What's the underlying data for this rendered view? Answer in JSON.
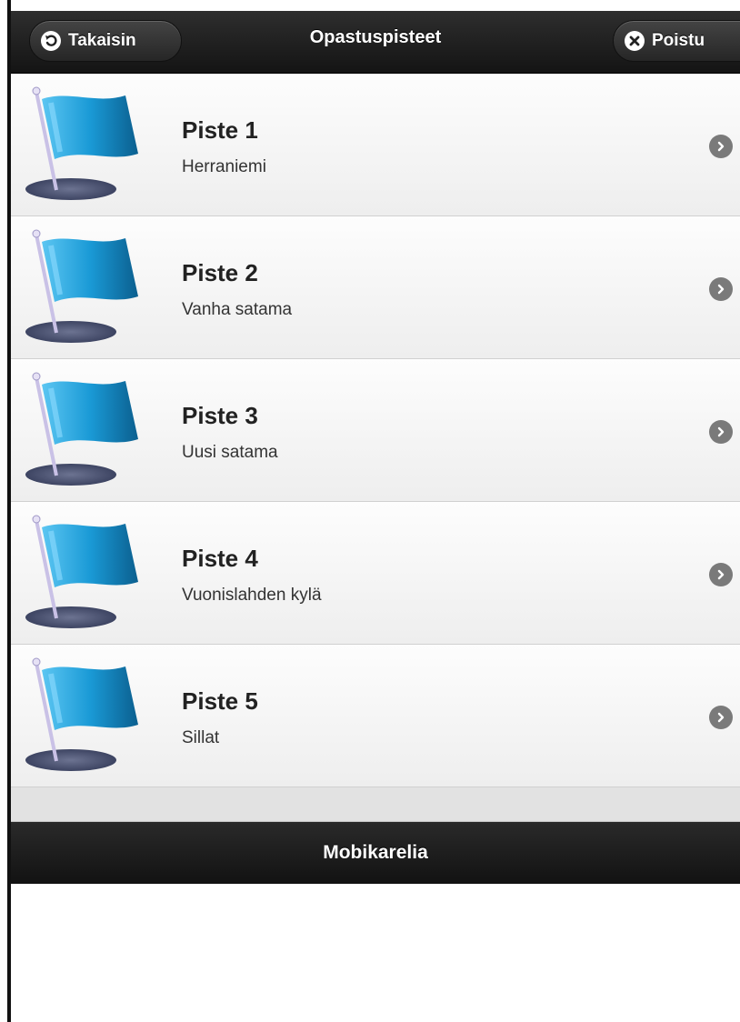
{
  "header": {
    "title": "Opastuspisteet",
    "back_label": "Takaisin",
    "back_icon": "back-arrow-icon",
    "exit_label": "Poistu",
    "exit_icon": "close-icon"
  },
  "items": [
    {
      "title": "Piste 1",
      "subtitle": "Herraniemi",
      "icon": "flag-icon"
    },
    {
      "title": "Piste 2",
      "subtitle": "Vanha satama",
      "icon": "flag-icon"
    },
    {
      "title": "Piste 3",
      "subtitle": "Uusi satama",
      "icon": "flag-icon"
    },
    {
      "title": "Piste 4",
      "subtitle": "Vuonislahden kylä",
      "icon": "flag-icon"
    },
    {
      "title": "Piste 5",
      "subtitle": "Sillat",
      "icon": "flag-icon"
    }
  ],
  "footer": {
    "title": "Mobikarelia"
  },
  "colors": {
    "header_bg": "#1e1e1e",
    "flag_blue": "#1a9ad6",
    "arrow_gray": "#7a7a7a"
  }
}
